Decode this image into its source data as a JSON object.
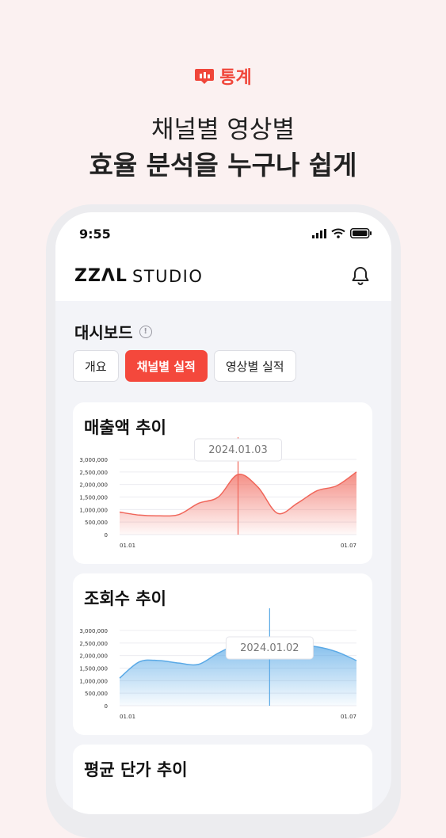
{
  "hero": {
    "tag_label": "통계",
    "line1": "채널별 영상별",
    "line2": "효율 분석을 누구나 쉽게"
  },
  "status_bar": {
    "time": "9:55"
  },
  "app": {
    "logo_mark": "ZZΛL",
    "logo_text": "STUDIO",
    "dashboard_title": "대시보드",
    "info_icon": "!"
  },
  "tabs": [
    {
      "label": "개요",
      "active": false
    },
    {
      "label": "채널별 실적",
      "active": true
    },
    {
      "label": "영상별 실적",
      "active": false
    }
  ],
  "colors": {
    "accent": "#f4483c",
    "revenue_line": "#f0665a",
    "views_line": "#5aa9e6"
  },
  "cards": {
    "revenue_title": "매출액 추이",
    "views_title": "조회수 추이",
    "price_title": "평균 단가 추이"
  },
  "chart_data": [
    {
      "type": "area",
      "title": "매출액 추이",
      "y_ticks": [
        "3,000,000",
        "2,500,000",
        "2,000,000",
        "1,500,000",
        "1,000,000",
        "500,000",
        "0"
      ],
      "ylim": [
        0,
        3000000
      ],
      "x_labels": [
        "01.01",
        "01.07"
      ],
      "x": [
        0,
        0.5,
        1,
        1.5,
        2,
        2.5,
        3,
        3.5,
        4,
        4.5,
        5,
        5.5,
        6
      ],
      "values": [
        900000,
        780000,
        750000,
        800000,
        1250000,
        1500000,
        2400000,
        1900000,
        850000,
        1250000,
        1750000,
        1950000,
        2500000
      ],
      "tooltip": {
        "label": "2024.01.03",
        "x": 3
      },
      "grid": true,
      "legend": "none"
    },
    {
      "type": "area",
      "title": "조회수 추이",
      "y_ticks": [
        "3,000,000",
        "2,500,000",
        "2,000,000",
        "1,500,000",
        "1,000,000",
        "500,000",
        "0"
      ],
      "ylim": [
        0,
        3000000
      ],
      "x_labels": [
        "01.01",
        "01.07"
      ],
      "x": [
        0,
        0.5,
        1,
        1.5,
        2,
        2.5,
        3,
        3.5,
        4,
        4.5,
        5,
        5.5,
        6
      ],
      "values": [
        1100000,
        1750000,
        1800000,
        1700000,
        1650000,
        2100000,
        2450000,
        2500000,
        2250000,
        2400000,
        2350000,
        2150000,
        1800000
      ],
      "tooltip": {
        "label": "2024.01.02",
        "x": 3.8
      },
      "grid": true,
      "legend": "none"
    }
  ]
}
